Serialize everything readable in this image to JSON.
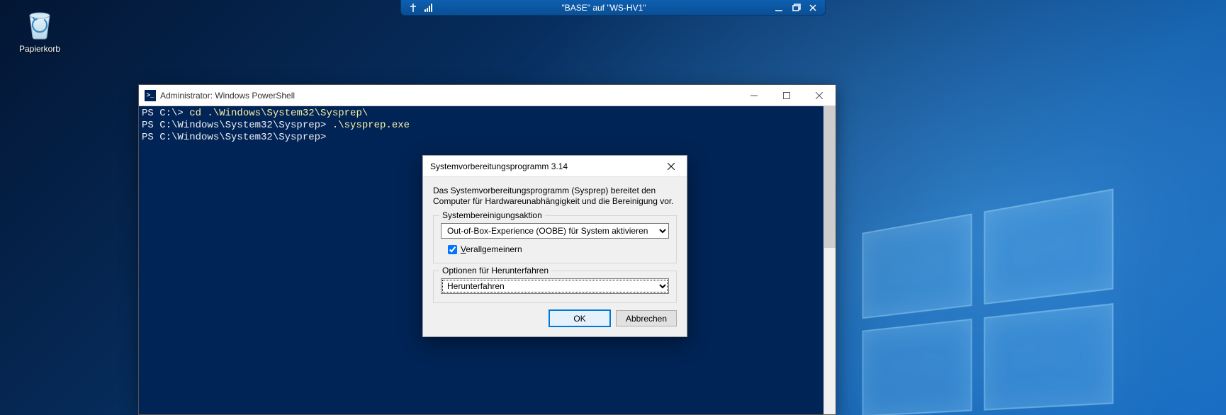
{
  "hv_bar": {
    "title": "\"BASE\" auf \"WS-HV1\""
  },
  "desktop": {
    "recycle_label": "Papierkorb"
  },
  "powershell": {
    "title": "Administrator: Windows PowerShell",
    "lines": {
      "l1_prompt": "PS C:\\> ",
      "l1_cmd": "cd .\\Windows\\System32\\Sysprep\\",
      "l2_prompt": "PS C:\\Windows\\System32\\Sysprep> ",
      "l2_cmd": ".\\sysprep.exe",
      "l3_prompt": "PS C:\\Windows\\System32\\Sysprep> "
    }
  },
  "sysprep": {
    "title": "Systemvorbereitungsprogramm 3.14",
    "description": "Das Systemvorbereitungsprogramm (Sysprep) bereitet den Computer für Hardwareunabhängigkeit und die Bereinigung vor.",
    "group1_legend": "Systembereinigungsaktion",
    "cleanup_selected": "Out-of-Box-Experience (OOBE) für System aktivieren",
    "generalize_label_pre": "V",
    "generalize_label_rest": "erallgemeinern",
    "generalize_checked": true,
    "group2_legend": "Optionen für Herunterfahren",
    "shutdown_selected": "Herunterfahren",
    "ok_label": "OK",
    "cancel_label": "Abbrechen"
  }
}
